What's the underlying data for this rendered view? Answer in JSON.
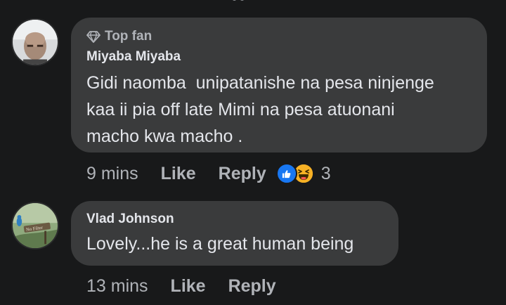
{
  "comments": [
    {
      "badge": "Top fan",
      "author": "Miyaba Miyaba",
      "text": "Gidi naomba  unipatanishe na pesa ninjenge\nkaa ii pia off late Mimi na pesa atuonani\nmacho kwa macho .",
      "time": "9 mins",
      "like_label": "Like",
      "reply_label": "Reply",
      "reaction_count": "3",
      "reaction_icons": [
        "like-icon",
        "haha-icon"
      ]
    },
    {
      "author": "Vlad Johnson",
      "avatar_caption": "No Filter",
      "text": "Lovely...he is a great human being",
      "time": "13 mins",
      "like_label": "Like",
      "reply_label": "Reply"
    }
  ],
  "colors": {
    "background": "#18191a",
    "bubble": "#3a3b3c",
    "secondary_text": "#b0b3b8",
    "primary_text": "#e4e6eb",
    "like_blue": "#1877f2",
    "haha_yellow": "#f7b125"
  }
}
